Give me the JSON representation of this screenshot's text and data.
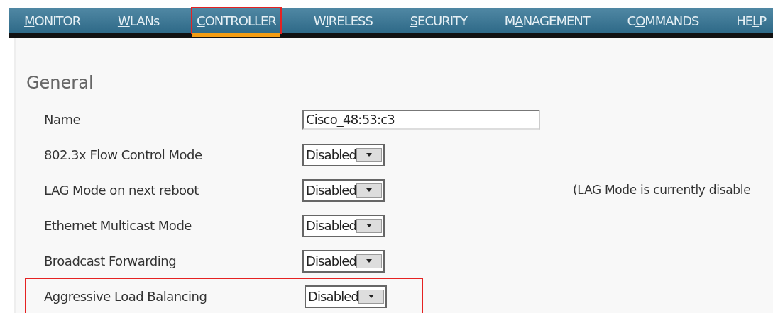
{
  "menu": [
    {
      "key": "M",
      "after": "ONITOR",
      "selected": false,
      "highlighted": false
    },
    {
      "key": "W",
      "after": "LANs",
      "selected": false,
      "highlighted": false
    },
    {
      "key": "C",
      "after": "ONTROLLER",
      "selected": true,
      "highlighted": true
    },
    {
      "before": "W",
      "key": "I",
      "after": "RELESS",
      "selected": false,
      "highlighted": false
    },
    {
      "key": "S",
      "after": "ECURITY",
      "selected": false,
      "highlighted": false
    },
    {
      "before": "M",
      "key": "A",
      "after": "NAGEMENT",
      "selected": false,
      "highlighted": false
    },
    {
      "before": "C",
      "key": "O",
      "after": "MMANDS",
      "selected": false,
      "highlighted": false
    },
    {
      "before": "HE",
      "key": "L",
      "after": "P",
      "selected": false,
      "highlighted": false
    }
  ],
  "section": {
    "title": "General"
  },
  "fields": [
    {
      "label": "Name",
      "kind": "text",
      "value": "Cisco_48:53:c3",
      "highlighted": false
    },
    {
      "label": "802.3x Flow Control Mode",
      "kind": "select",
      "value": "Disabled",
      "highlighted": false
    },
    {
      "label": "LAG Mode on next reboot",
      "kind": "select",
      "value": "Disabled",
      "note": "(LAG Mode is currently disable",
      "highlighted": false
    },
    {
      "label": "Ethernet Multicast Mode",
      "kind": "select",
      "value": "Disabled",
      "highlighted": false
    },
    {
      "label": "Broadcast Forwarding",
      "kind": "select",
      "value": "Disabled",
      "highlighted": false
    },
    {
      "label": "Aggressive Load Balancing",
      "kind": "select",
      "value": "Disabled",
      "highlighted": true
    }
  ]
}
